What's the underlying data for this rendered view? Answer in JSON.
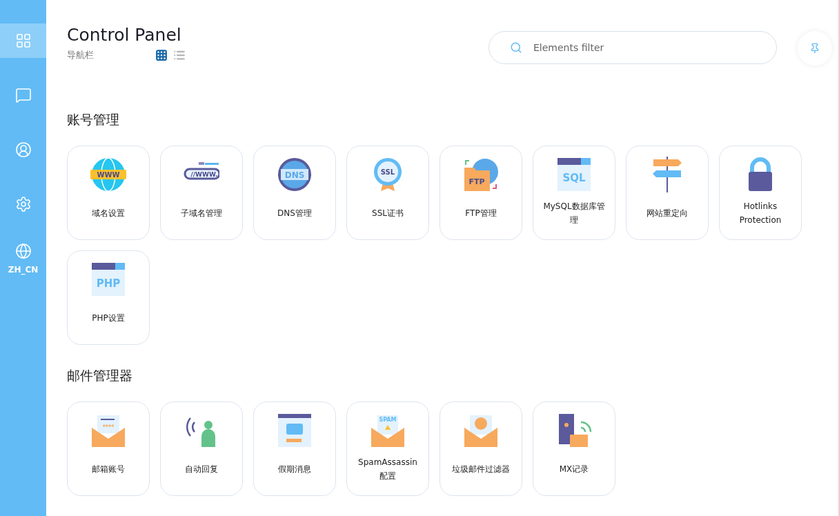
{
  "sidebar": {
    "items": [
      {
        "kind": "apps",
        "selected": true
      },
      {
        "kind": "chat",
        "selected": false
      },
      {
        "kind": "user",
        "selected": false
      },
      {
        "kind": "settings",
        "selected": false
      },
      {
        "kind": "language",
        "selected": false,
        "label": "ZH_CN"
      }
    ]
  },
  "header": {
    "title": "Control Panel",
    "subtitle": "导航栏",
    "views": [
      {
        "kind": "grid",
        "selected": true
      },
      {
        "kind": "list",
        "selected": false
      }
    ]
  },
  "search": {
    "placeholder": "Elements filter"
  },
  "sections": [
    {
      "title": "账号管理",
      "items": [
        {
          "kind": "www",
          "icon_text": "WWW",
          "label": "域名设置"
        },
        {
          "kind": "subdomain",
          "icon_text": "//WWW.",
          "label": "子域名管理"
        },
        {
          "kind": "dns",
          "icon_text": "DNS",
          "label": "DNS管理"
        },
        {
          "kind": "ssl",
          "icon_text": "SSL",
          "label": "SSL证书"
        },
        {
          "kind": "ftp",
          "icon_text": "FTP",
          "label": "FTP管理"
        },
        {
          "kind": "sql",
          "icon_text": "SQL",
          "label": "MySQL数据库管理"
        },
        {
          "kind": "redirect",
          "label": "网站重定向"
        },
        {
          "kind": "lock",
          "label": "Hotlinks Protection"
        },
        {
          "kind": "php",
          "icon_text": "PHP",
          "label": "PHP设置"
        }
      ]
    },
    {
      "title": "邮件管理器",
      "items": [
        {
          "kind": "mailaccount",
          "icon_text": "****",
          "label": "邮箱账号"
        },
        {
          "kind": "autoreply",
          "label": "自动回复"
        },
        {
          "kind": "vacation",
          "label": "假期消息"
        },
        {
          "kind": "spam",
          "icon_text": "SPAM",
          "label": "SpamAssassin配置"
        },
        {
          "kind": "mailfilter",
          "label": "垃圾邮件过滤器"
        },
        {
          "kind": "mx",
          "label": "MX记录"
        }
      ]
    }
  ]
}
